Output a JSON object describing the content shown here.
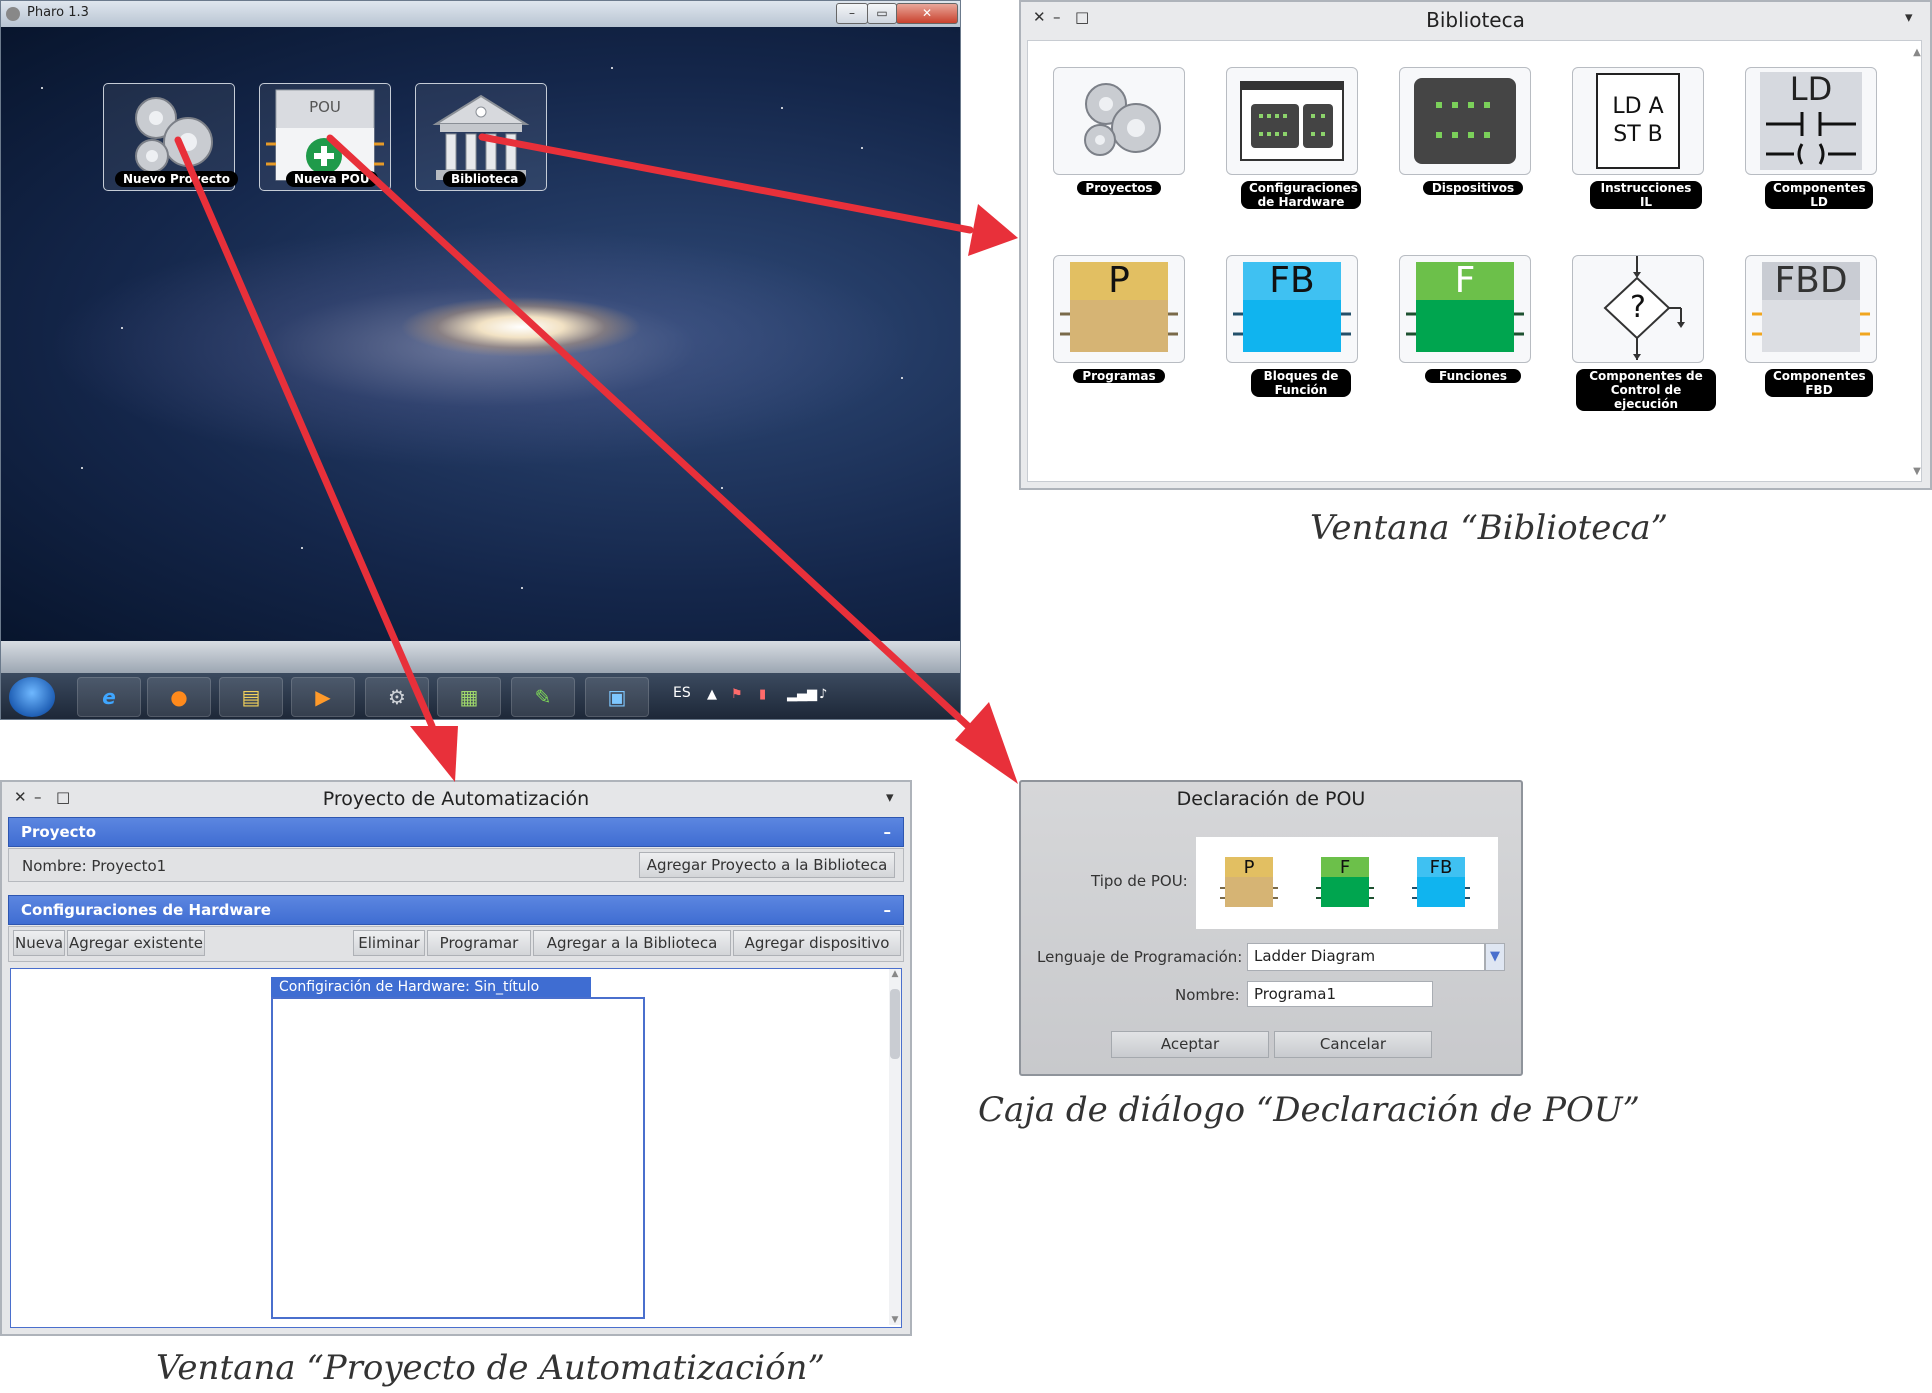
{
  "pharo_window": {
    "title": "Pharo 1.3",
    "controls": {
      "minimize": "–",
      "maximize": "▭",
      "close": "✕"
    },
    "desktop_icons": [
      {
        "label": "Nuevo Proyecto",
        "icon": "gears-icon"
      },
      {
        "label": "Nueva POU",
        "icon": "pou-add-icon",
        "icon_text": "POU"
      },
      {
        "label": "Biblioteca",
        "icon": "library-building-icon"
      }
    ],
    "taskbar": {
      "buttons": [
        "start-orb-icon",
        "internet-explorer-icon",
        "firefox-icon",
        "file-explorer-icon",
        "media-player-icon",
        "pharo-gears-icon",
        "chart-app-icon",
        "vector-app-icon",
        "control-panel-icon"
      ],
      "language": "ES"
    }
  },
  "biblioteca": {
    "title": "Biblioteca",
    "items": [
      {
        "label1": "Proyectos",
        "label2": "",
        "label3": "",
        "icon": "gears-icon"
      },
      {
        "label1": "Configuraciones",
        "label2": "de Hardware",
        "label3": "",
        "icon": "hardware-config-icon"
      },
      {
        "label1": "Dispositivos",
        "label2": "",
        "label3": "",
        "icon": "device-icon"
      },
      {
        "label1": "Instrucciones",
        "label2": "IL",
        "label3": "",
        "icon": "il-instructions-icon",
        "icon_text1": "LD A",
        "icon_text2": "ST B"
      },
      {
        "label1": "Componentes",
        "label2": "LD",
        "label3": "",
        "icon": "ladder-icon",
        "icon_text1": "LD"
      },
      {
        "label1": "Programas",
        "label2": "",
        "label3": "",
        "icon": "program-block-icon",
        "icon_text1": "P"
      },
      {
        "label1": "Bloques de",
        "label2": "Función",
        "label3": "",
        "icon": "function-block-icon",
        "icon_text1": "FB"
      },
      {
        "label1": "Funciones",
        "label2": "",
        "label3": "",
        "icon": "function-icon",
        "icon_text1": "F"
      },
      {
        "label1": "Componentes de",
        "label2": "Control de",
        "label3": "ejecución",
        "icon": "flow-decision-icon",
        "icon_text1": "?"
      },
      {
        "label1": "Componentes",
        "label2": "FBD",
        "label3": "",
        "icon": "fbd-icon",
        "icon_text1": "FBD"
      }
    ]
  },
  "pou_dialog": {
    "title": "Declaración de POU",
    "tipo_label": "Tipo de POU:",
    "types": [
      "P",
      "F",
      "FB"
    ],
    "lenguaje_label": "Lenguaje de Programación:",
    "lenguaje_value": "Ladder Diagram",
    "nombre_label": "Nombre:",
    "nombre_value": "Programa1",
    "accept": "Aceptar",
    "cancel": "Cancelar"
  },
  "proyecto_window": {
    "title": "Proyecto de Automatización",
    "section1": {
      "title": "Proyecto",
      "collapse": "–",
      "name_text": "Nombre: Proyecto1",
      "button": "Agregar Proyecto a la Biblioteca"
    },
    "section2": {
      "title": "Configuraciones de Hardware",
      "collapse": "–",
      "buttons": [
        "Nueva",
        "Agregar existente",
        "Eliminar",
        "Programar",
        "Agregar a la Biblioteca",
        "Agregar dispositivo"
      ],
      "inner_window_title": "Configiración de Hardware: Sin_título"
    }
  },
  "captions": {
    "biblioteca": "Ventana “Biblioteca”",
    "pou": "Caja de diálogo “Declaración de POU”",
    "proyecto": "Ventana “Proyecto de Automatización”"
  },
  "colors": {
    "arrow": "#e8303a",
    "section_blue": "#3f6dd2",
    "program_tan": "#d9b46a",
    "function_green": "#2fa84f",
    "fb_cyan": "#19b7f0"
  }
}
